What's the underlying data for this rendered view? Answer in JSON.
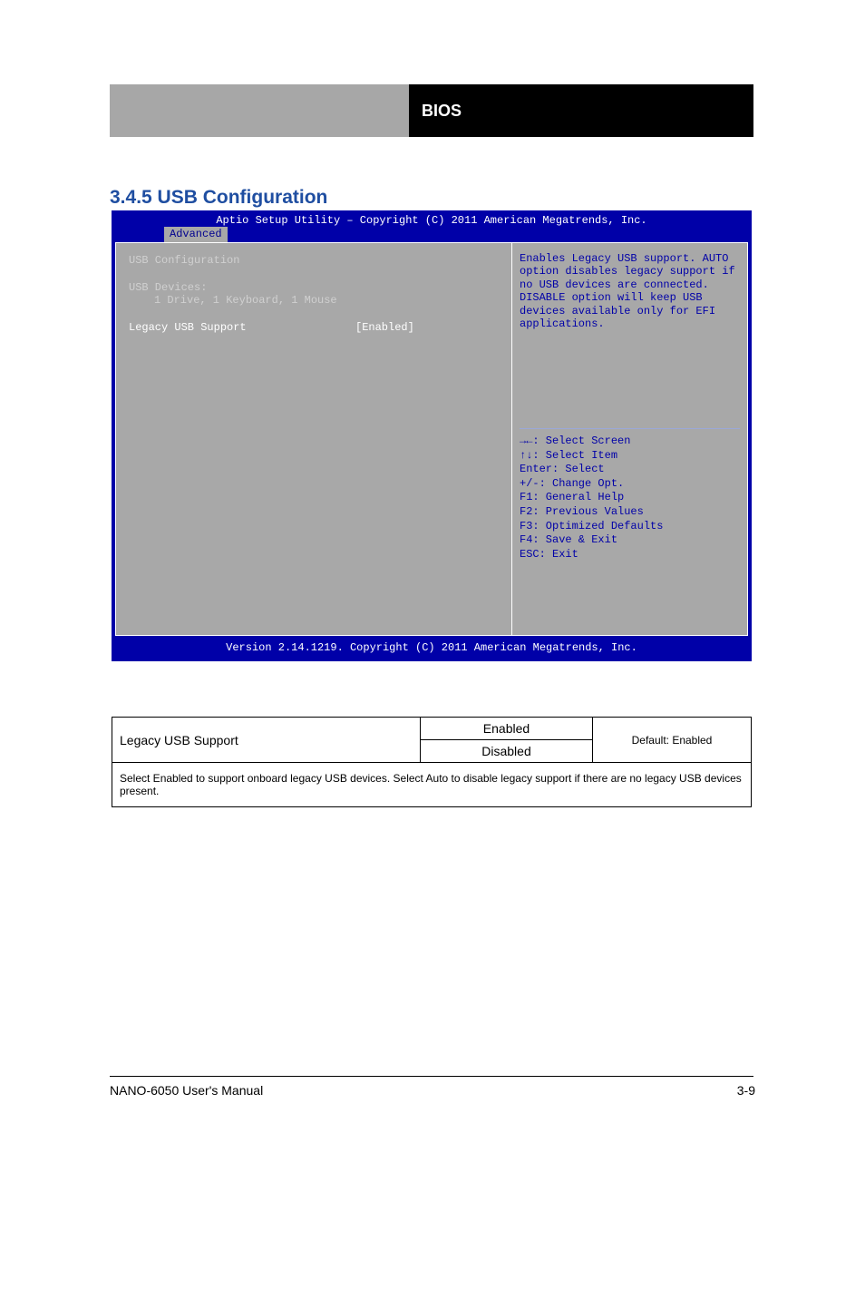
{
  "header": {
    "left": "",
    "right": "BIOS"
  },
  "section_title": "3.4.5 USB Configuration",
  "bios": {
    "top_banner": "Aptio Setup Utility – Copyright (C) 2011 American Megatrends, Inc.",
    "tab": "Advanced",
    "left": {
      "heading": "USB Configuration",
      "devices_label": "USB Devices:",
      "devices_value": "1 Drive, 1 Keyboard, 1 Mouse",
      "setting_label": "Legacy USB Support",
      "setting_value": "[Enabled]"
    },
    "help_text": "Enables Legacy USB support. AUTO option disables legacy support if no USB devices are connected. DISABLE option will keep USB devices available only for EFI applications.",
    "keys": [
      "→←: Select Screen",
      "↑↓: Select Item",
      "Enter: Select",
      "+/-: Change Opt.",
      "F1: General Help",
      "F2: Previous Values",
      "F3: Optimized Defaults",
      "F4: Save & Exit",
      "ESC: Exit"
    ],
    "bottom_banner": "Version 2.14.1219. Copyright (C) 2011 American Megatrends, Inc."
  },
  "table": {
    "setting": "Legacy USB Support",
    "options": [
      "Enabled",
      "Disabled"
    ],
    "default_label": "Default: Enabled",
    "description": "Select Enabled to support onboard legacy USB devices. Select Auto to disable legacy support if there are no legacy USB devices present."
  },
  "footer": {
    "left": "NANO-6050 User's Manual",
    "right": "3-9"
  }
}
